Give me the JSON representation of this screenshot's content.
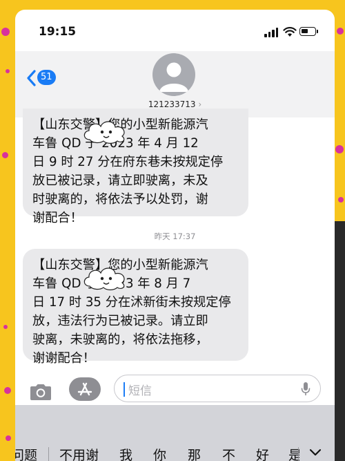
{
  "status_bar": {
    "time": "19:15"
  },
  "header": {
    "back_badge": "51",
    "contact": "121233713",
    "contact_chevron": "›"
  },
  "messages": [
    {
      "text": "【山东交警】您的小型新能源汽\n车鲁 QD      于 2023 年 4 月 12\n日 9 时 27 分在府东巷未按规定停\n放已被记录，请立即驶离，未及\n时驶离的，将依法予以处罚，谢\n谢配合！"
    },
    {
      "text": "【山东交警】您的小型新能源汽\n车鲁 QD      于 2023 年 8 月 7\n日 17 时 35 分在沭新街未按规定停\n放，违法行为已被记录。请立即\n驶离，未驶离的，将依法拖移，\n谢谢配合！"
    }
  ],
  "timestamp": "昨天 17:37",
  "input": {
    "placeholder": "短信"
  },
  "suggestions": [
    "问题",
    "不用谢",
    "我",
    "你",
    "那",
    "不",
    "好",
    "是"
  ],
  "icons": {
    "back": "chevron-left-icon",
    "avatar": "person-avatar-icon",
    "camera": "camera-icon",
    "appstore": "app-store-icon",
    "mic": "microphone-icon",
    "keyboard_expand": "chevron-down-icon",
    "cloud_sticker": "cloud-face-sticker"
  },
  "colors": {
    "accent": "#1a7cf5",
    "bubble": "#e9e9eb",
    "background": "#f7c51e",
    "decor_dots": "#d8329c"
  }
}
